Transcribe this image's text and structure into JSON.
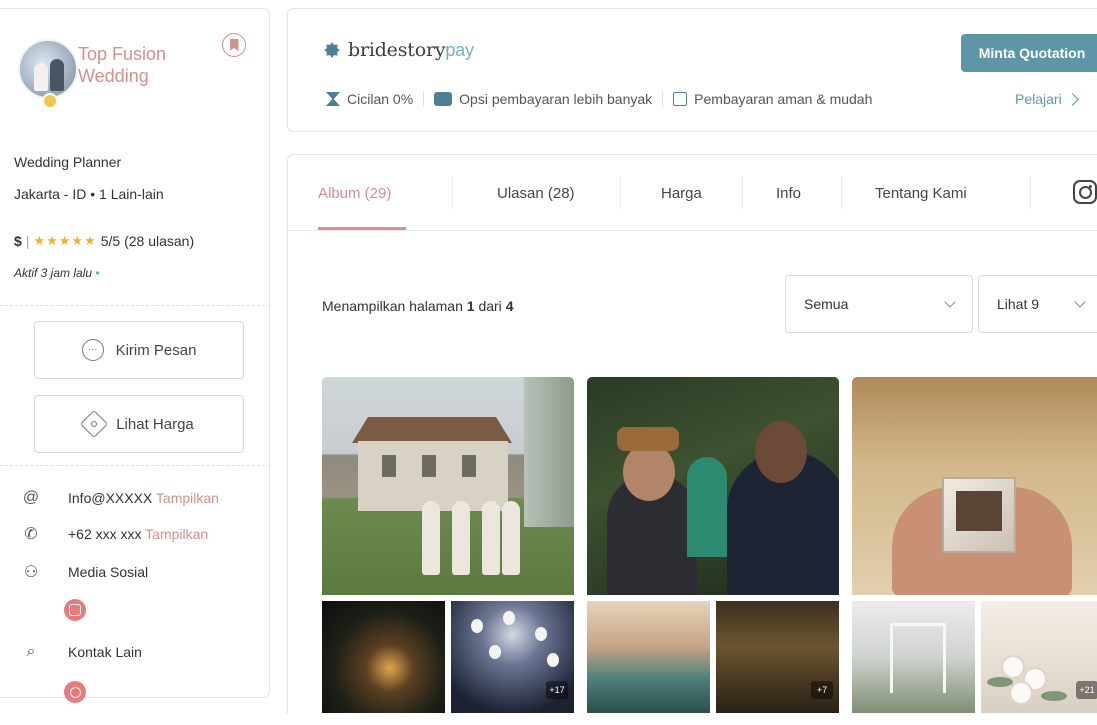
{
  "vendor": {
    "name": "Top Fusion Wedding",
    "category": "Wedding Planner",
    "location": "Jakarta - ID • 1 Lain-lain",
    "price_level": "$",
    "separator": "|",
    "stars": "★★★★★",
    "rating_text": "5/5 (28 ulasan)",
    "active_text": "Aktif 3 jam lalu",
    "active_dot": "•"
  },
  "actions": {
    "message_label": "Kirim Pesan",
    "price_label": "Lihat Harga"
  },
  "contact": {
    "email": "Info@XXXXX",
    "email_show": "Tampilkan",
    "phone": "+62 xxx xxx",
    "phone_show": "Tampilkan",
    "social_label": "Media Sosial",
    "other_label": "Kontak Lain"
  },
  "pay": {
    "brand": "bridestory",
    "brand_suffix": "pay",
    "features": [
      "Cicilan 0%",
      "Opsi pembayaran lebih banyak",
      "Pembayaran aman & mudah"
    ],
    "quote_button": "Minta Quotation",
    "learn_link": "Pelajari"
  },
  "tabs": [
    {
      "label": "Album (29)",
      "active": true
    },
    {
      "label": "Ulasan (28)",
      "active": false
    },
    {
      "label": "Harga",
      "active": false
    },
    {
      "label": "Info",
      "active": false
    },
    {
      "label": "Tentang Kami",
      "active": false
    }
  ],
  "listing": {
    "page_prefix": "Menampilkan halaman",
    "page_current": "1",
    "page_of": "dari",
    "page_total": "4",
    "filter_value": "Semua",
    "view_value": "Lihat 9"
  },
  "albums": [
    {
      "more": "+17"
    },
    {
      "more": "+7"
    },
    {
      "more": "+21"
    }
  ],
  "colors": {
    "accent_pink": "#d48f8f",
    "accent_teal": "#5f96a7",
    "star": "#f2b134"
  }
}
